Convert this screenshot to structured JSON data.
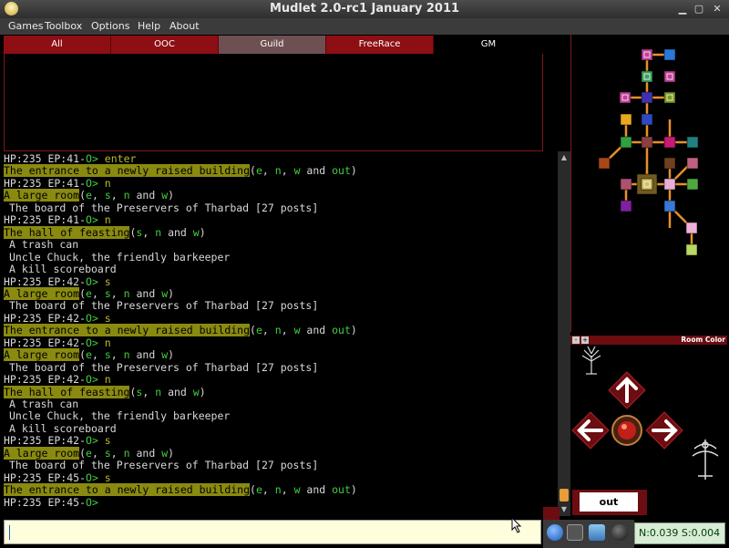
{
  "window": {
    "title": "Mudlet 2.0-rc1 January 2011"
  },
  "menu": [
    "Games",
    "Toolbox",
    "Options",
    "Help",
    "About"
  ],
  "tabs": [
    "All",
    "OOC",
    "Guild",
    "FreeRace",
    "GM"
  ],
  "console": [
    {
      "prompt": "HP:235 EP:41-",
      "o": "O>",
      "cmd": " enter"
    },
    {
      "room": "The entrance to a newly raised building",
      "exits": [
        "e",
        "n",
        "w"
      ],
      "and": "out"
    },
    {
      "prompt": "HP:235 EP:41-",
      "o": "O>",
      "cmd": " n"
    },
    {
      "room": "A large room",
      "exits": [
        "e",
        "s",
        "n"
      ],
      "and": "w"
    },
    {
      "text": "The board of the Preservers of Tharbad [27 posts]"
    },
    {
      "prompt": "HP:235 EP:41-",
      "o": "O>",
      "cmd": " n"
    },
    {
      "room": "The hall of feasting",
      "exits": [
        "s",
        "n"
      ],
      "and": "w"
    },
    {
      "text": "A trash can"
    },
    {
      "text": "Uncle Chuck, the friendly barkeeper"
    },
    {
      "text": "A kill scoreboard"
    },
    {
      "prompt": "HP:235 EP:42-",
      "o": "O>",
      "cmd": " s"
    },
    {
      "room": "A large room",
      "exits": [
        "e",
        "s",
        "n"
      ],
      "and": "w"
    },
    {
      "text": "The board of the Preservers of Tharbad [27 posts]"
    },
    {
      "prompt": "HP:235 EP:42-",
      "o": "O>",
      "cmd": " s"
    },
    {
      "room": "The entrance to a newly raised building",
      "exits": [
        "e",
        "n",
        "w"
      ],
      "and": "out"
    },
    {
      "prompt": "HP:235 EP:42-",
      "o": "O>",
      "cmd": " n"
    },
    {
      "room": "A large room",
      "exits": [
        "e",
        "s",
        "n"
      ],
      "and": "w"
    },
    {
      "text": "The board of the Preservers of Tharbad [27 posts]"
    },
    {
      "prompt": "HP:235 EP:42-",
      "o": "O>",
      "cmd": " n"
    },
    {
      "room": "The hall of feasting",
      "exits": [
        "s",
        "n"
      ],
      "and": "w"
    },
    {
      "text": "A trash can"
    },
    {
      "text": "Uncle Chuck, the friendly barkeeper"
    },
    {
      "text": "A kill scoreboard"
    },
    {
      "prompt": "HP:235 EP:42-",
      "o": "O>",
      "cmd": " s"
    },
    {
      "room": "A large room",
      "exits": [
        "e",
        "s",
        "n"
      ],
      "and": "w"
    },
    {
      "text": "The board of the Preservers of Tharbad [27 posts]"
    },
    {
      "prompt": "HP:235 EP:45-",
      "o": "O>",
      "cmd": " s"
    },
    {
      "room": "The entrance to a newly raised building",
      "exits": [
        "e",
        "n",
        "w"
      ],
      "and": "out"
    },
    {
      "prompt": "HP:235 EP:45-",
      "o": "O>",
      "cmd": ""
    }
  ],
  "compass": {
    "minus": "-",
    "plus": "+",
    "room_color": "Room Color"
  },
  "out_button": "out",
  "status": "N:0.039 S:0.004",
  "icons": [
    "info-icon",
    "cassette-icon",
    "folder-icon",
    "disc-icon"
  ],
  "colors": {
    "accent": "#8d0f14",
    "prompt_green": "#3fcf3f",
    "room_highlight": "#8a8a10",
    "input_bg": "#fffedc"
  }
}
